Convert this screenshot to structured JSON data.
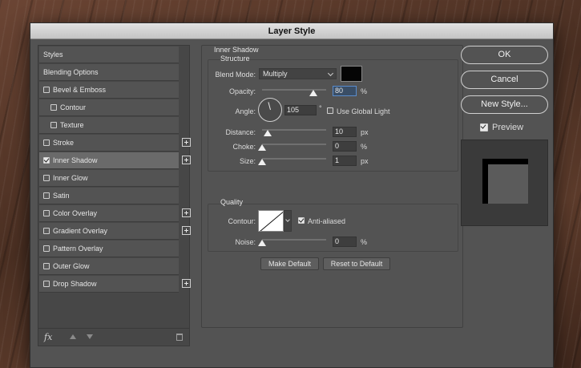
{
  "window": {
    "title": "Layer Style"
  },
  "styles_list": {
    "items": [
      {
        "label": "Styles",
        "checkbox": false,
        "checked": false,
        "plus": false,
        "indent": false,
        "header": true
      },
      {
        "label": "Blending Options",
        "checkbox": false,
        "checked": false,
        "plus": false,
        "indent": false,
        "header": true
      },
      {
        "label": "Bevel & Emboss",
        "checkbox": true,
        "checked": false,
        "plus": false,
        "indent": false
      },
      {
        "label": "Contour",
        "checkbox": true,
        "checked": false,
        "plus": false,
        "indent": true
      },
      {
        "label": "Texture",
        "checkbox": true,
        "checked": false,
        "plus": false,
        "indent": true
      },
      {
        "label": "Stroke",
        "checkbox": true,
        "checked": false,
        "plus": true,
        "indent": false
      },
      {
        "label": "Inner Shadow",
        "checkbox": true,
        "checked": true,
        "plus": true,
        "indent": false,
        "selected": true
      },
      {
        "label": "Inner Glow",
        "checkbox": true,
        "checked": false,
        "plus": false,
        "indent": false
      },
      {
        "label": "Satin",
        "checkbox": true,
        "checked": false,
        "plus": false,
        "indent": false
      },
      {
        "label": "Color Overlay",
        "checkbox": true,
        "checked": false,
        "plus": true,
        "indent": false
      },
      {
        "label": "Gradient Overlay",
        "checkbox": true,
        "checked": false,
        "plus": true,
        "indent": false
      },
      {
        "label": "Pattern Overlay",
        "checkbox": true,
        "checked": false,
        "plus": false,
        "indent": false
      },
      {
        "label": "Outer Glow",
        "checkbox": true,
        "checked": false,
        "plus": false,
        "indent": false
      },
      {
        "label": "Drop Shadow",
        "checkbox": true,
        "checked": false,
        "plus": true,
        "indent": false
      }
    ],
    "footer": {
      "fx_label": "fx"
    }
  },
  "inner_shadow": {
    "title": "Inner Shadow",
    "structure": {
      "title": "Structure",
      "blend_mode_label": "Blend Mode:",
      "blend_mode_value": "Multiply",
      "shadow_color": "#050505",
      "opacity_label": "Opacity:",
      "opacity_value": "80",
      "opacity_unit": "%",
      "opacity_fraction": 0.8,
      "angle_label": "Angle:",
      "angle_value": "105",
      "angle_unit": "°",
      "use_global_light_label": "Use Global Light",
      "use_global_light_checked": false,
      "distance_label": "Distance:",
      "distance_value": "10",
      "distance_unit": "px",
      "choke_label": "Choke:",
      "choke_value": "0",
      "choke_unit": "%",
      "size_label": "Size:",
      "size_value": "1",
      "size_unit": "px"
    },
    "quality": {
      "title": "Quality",
      "contour_label": "Contour:",
      "anti_aliased_label": "Anti-aliased",
      "anti_aliased_checked": true,
      "noise_label": "Noise:",
      "noise_value": "0",
      "noise_unit": "%"
    },
    "make_default_label": "Make Default",
    "reset_default_label": "Reset to Default"
  },
  "actions": {
    "ok_label": "OK",
    "cancel_label": "Cancel",
    "new_style_label": "New Style...",
    "preview_label": "Preview",
    "preview_checked": true
  }
}
